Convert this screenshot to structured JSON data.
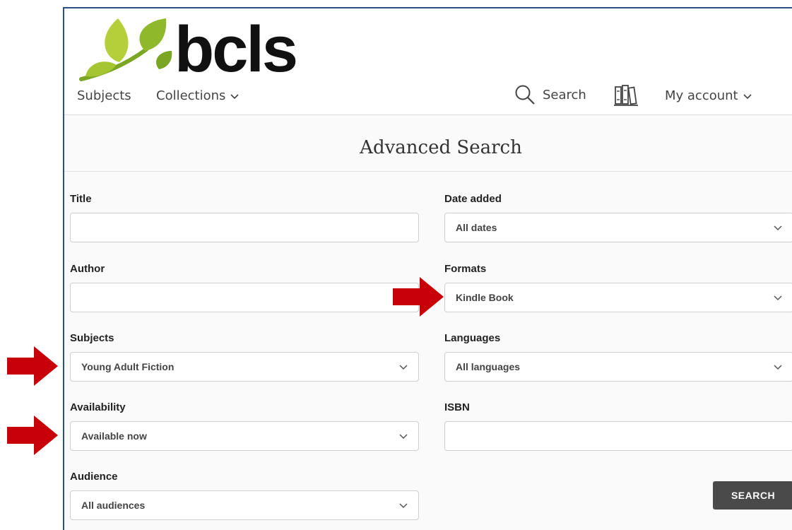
{
  "header": {
    "logo_text": "bcls",
    "nav": [
      {
        "label": "Subjects"
      },
      {
        "label": "Collections"
      }
    ],
    "search_label": "Search",
    "account_label": "My account"
  },
  "page": {
    "title": "Advanced Search"
  },
  "form": {
    "title": {
      "label": "Title",
      "value": ""
    },
    "author": {
      "label": "Author",
      "value": ""
    },
    "subjects": {
      "label": "Subjects",
      "value": "Young Adult Fiction"
    },
    "availability": {
      "label": "Availability",
      "value": "Available now"
    },
    "audience": {
      "label": "Audience",
      "value": "All audiences"
    },
    "date_added": {
      "label": "Date added",
      "value": "All dates"
    },
    "formats": {
      "label": "Formats",
      "value": "Kindle Book"
    },
    "languages": {
      "label": "Languages",
      "value": "All languages"
    },
    "isbn": {
      "label": "ISBN",
      "value": ""
    },
    "search_button": "SEARCH"
  },
  "annotation_arrows": {
    "color": "#c8000a",
    "targets": [
      "formats",
      "subjects",
      "availability"
    ]
  },
  "colors": {
    "frame_border": "#2b4f86",
    "logo_leaf_light": "#b5cf3a",
    "logo_leaf_dark": "#7aa624",
    "button_bg": "#4a4a4a"
  },
  "icons": [
    "bcls-leaf-logo",
    "search-icon",
    "books-icon",
    "chevron-down-icon",
    "red-arrow"
  ]
}
